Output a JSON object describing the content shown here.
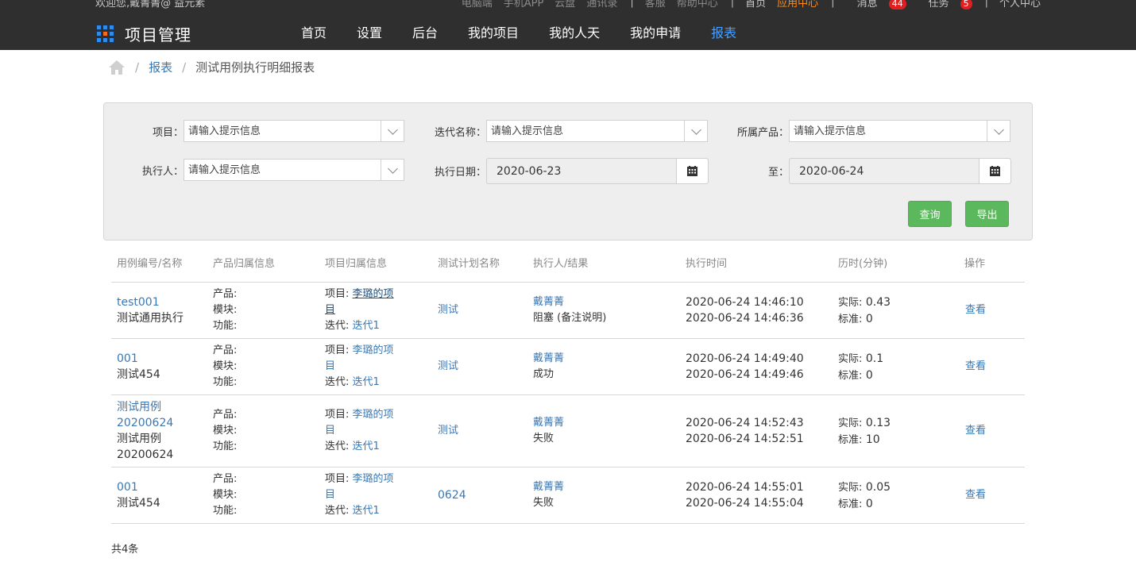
{
  "topbar": {
    "welcome": "欢迎您,戴菁菁@ 益元素",
    "links": [
      "电脑端",
      "手机APP",
      "云盘",
      "通讯录"
    ],
    "links2": [
      "客服",
      "帮助中心"
    ],
    "home": "首页",
    "app_center": "应用中心",
    "messages": "消息",
    "messages_count": "44",
    "tasks": "任务",
    "tasks_count": "5",
    "personal": "个人中心"
  },
  "brand": {
    "title": "项目管理",
    "grid_colors": [
      "#2d8cf0",
      "#2d8cf0",
      "#2d8cf0",
      "#2d8cf0",
      "#ff6a1a",
      "#2d8cf0",
      "#2d8cf0",
      "#2d8cf0",
      "#2d8cf0"
    ]
  },
  "nav": {
    "items": [
      "首页",
      "设置",
      "后台",
      "我的项目",
      "我的人天",
      "我的申请",
      "报表"
    ],
    "active_index": 6,
    "active_color": "#4aa0ff"
  },
  "breadcrumb": {
    "home_icon": "home-icon",
    "parent": "报表",
    "current": "测试用例执行明细报表"
  },
  "filters": {
    "project_label": "项目：",
    "iteration_label": "迭代名称：",
    "product_label": "所属产品：",
    "executor_label": "执行人：",
    "exec_date_label": "执行日期：",
    "to_label": "至：",
    "placeholder": "请输入提示信息",
    "date_from": "2020-06-23",
    "date_to": "2020-06-24",
    "query_button": "查询",
    "export_button": "导出",
    "button_color": "#5cb85c"
  },
  "table": {
    "headers": [
      "用例编号/名称",
      "产品归属信息",
      "项目归属信息",
      "测试计划名称",
      "执行人/结果",
      "执行时间",
      "历时(分钟)",
      "操作"
    ],
    "product_labels": [
      "产品:",
      "模块:",
      "功能:"
    ],
    "project_prefix": "项目:",
    "iteration_prefix": "迭代:",
    "actual_prefix": "实际:",
    "standard_prefix": "标准:",
    "rows": [
      {
        "id_lines": [
          "test001"
        ],
        "name_lines": [
          "测试通用执行"
        ],
        "project_lines": [
          "李璐的项",
          "目"
        ],
        "iteration": "迭代1",
        "plan": "测试",
        "executor": "戴菁菁",
        "result": "阻塞 (备注说明)",
        "time_start": "2020-06-24 14:46:10",
        "time_end": "2020-06-24 14:46:36",
        "actual": "0.43",
        "standard": "0",
        "action": "查看"
      },
      {
        "id_lines": [
          "001"
        ],
        "name_lines": [
          "测试454"
        ],
        "project_lines": [
          "李璐的项",
          "目"
        ],
        "iteration": "迭代1",
        "plan": "测试",
        "executor": "戴菁菁",
        "result": "成功",
        "time_start": "2020-06-24 14:49:40",
        "time_end": "2020-06-24 14:49:46",
        "actual": "0.1",
        "standard": "0",
        "action": "查看"
      },
      {
        "id_lines": [
          "测试用例",
          "20200624"
        ],
        "name_lines": [
          "测试用例",
          "20200624"
        ],
        "project_lines": [
          "李璐的项",
          "目"
        ],
        "iteration": "迭代1",
        "plan": "测试",
        "executor": "戴菁菁",
        "result": "失败",
        "time_start": "2020-06-24 14:52:43",
        "time_end": "2020-06-24 14:52:51",
        "actual": "0.13",
        "standard": "10",
        "action": "查看"
      },
      {
        "id_lines": [
          "001"
        ],
        "name_lines": [
          "测试454"
        ],
        "project_lines": [
          "李璐的项",
          "目"
        ],
        "iteration": "迭代1",
        "plan": "0624",
        "executor": "戴菁菁",
        "result": "失败",
        "time_start": "2020-06-24 14:55:01",
        "time_end": "2020-06-24 14:55:04",
        "actual": "0.05",
        "standard": "0",
        "action": "查看"
      }
    ]
  },
  "footer": {
    "total": "共4条"
  },
  "colors": {
    "link": "#3a78b4",
    "topbar_bg": "#2f2f2f",
    "accent_orange": "#ff8c1a",
    "badge_red": "#e02020"
  }
}
